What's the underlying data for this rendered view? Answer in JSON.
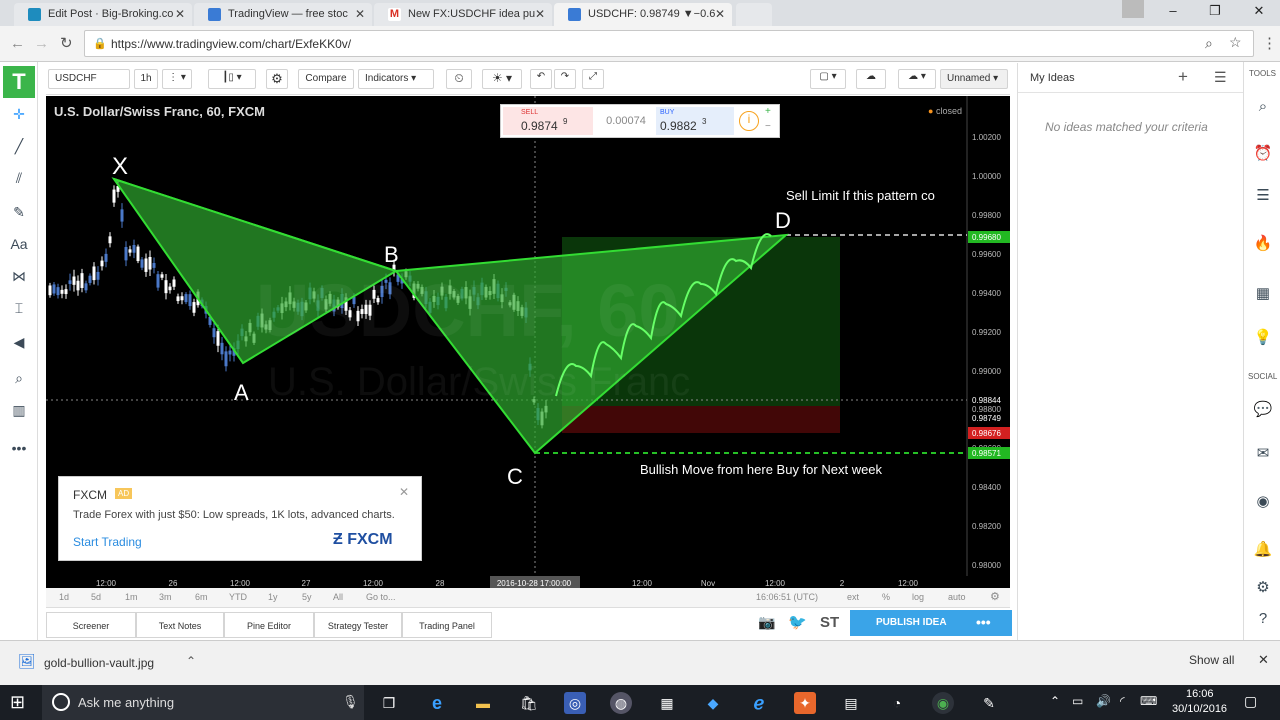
{
  "browser": {
    "tabs": [
      {
        "label": "Edit Post · Big-Broking.co",
        "icon_color": "#1e8cbe"
      },
      {
        "label": "TradingView — free stoc",
        "icon_color": "#3a7bd5"
      },
      {
        "label": "New FX:USDCHF idea pu",
        "icon_color": "#d93025"
      },
      {
        "label": "USDCHF: 0.98749 ▼−0.6",
        "icon_color": "#3a7bd5"
      }
    ],
    "url_secure": "https://",
    "url": "https://www.tradingview.com/chart/ExfeKK0v/"
  },
  "toolbar": {
    "symbol": "USDCHF",
    "interval": "1h",
    "compare": "Compare",
    "indicators": "Indicators",
    "layout_name": "Unnamed"
  },
  "chart": {
    "title": "U.S. Dollar/Swiss Franc, 60, FXCM",
    "watermark_symbol": "USDCHF, 60",
    "watermark_name": "U.S. Dollar/Swiss Franc",
    "market_status": "closed",
    "trade": {
      "sell_label": "SELL",
      "sell_price": "0.9874",
      "sell_sup": "9",
      "spread": "0.00074",
      "buy_label": "BUY",
      "buy_price": "0.9882",
      "buy_sup": "3"
    },
    "annotations": {
      "x": "X",
      "a": "A",
      "b": "B",
      "c": "C",
      "d": "D",
      "sell_note": "Sell Limit If this pattern co",
      "buy_note": "Bullish Move from here Buy for Next week"
    },
    "price_axis": [
      "1.00200",
      "1.00000",
      "0.99800",
      "0.99600",
      "0.99400",
      "0.99200",
      "0.99000",
      "0.98800",
      "0.98600",
      "0.98400",
      "0.98200",
      "0.98000"
    ],
    "price_tags": [
      {
        "label": "0.99680",
        "color": "#22b822"
      },
      {
        "label": "0.98844",
        "color": "#000000"
      },
      {
        "label": "0.98749",
        "color": "#000000"
      },
      {
        "label": "0.98676",
        "color": "#d32020"
      },
      {
        "label": "0.98571",
        "color": "#22b822"
      }
    ],
    "time_axis": [
      "12:00",
      "26",
      "12:00",
      "27",
      "12:00",
      "28",
      "2016-10-28 17:00:00",
      "12:00",
      "Nov",
      "12:00",
      "2",
      "12:00"
    ]
  },
  "ad": {
    "brand": "FXCM",
    "badge": "AD",
    "text": "Trade Forex with just $50: Low spreads, 1K lots, advanced charts.",
    "cta": "Start Trading",
    "logo": "FXCM"
  },
  "range": {
    "buttons": [
      "1d",
      "5d",
      "1m",
      "3m",
      "6m",
      "YTD",
      "1y",
      "5y",
      "All",
      "Go to..."
    ],
    "time": "16:06:51 (UTC)",
    "ext": "ext",
    "pct": "%",
    "log": "log",
    "auto": "auto"
  },
  "bottom_tabs": [
    "Screener",
    "Text Notes",
    "Pine Editor",
    "Strategy Tester",
    "Trading Panel"
  ],
  "publish": "PUBLISH IDEA",
  "ideas": {
    "title": "My Ideas",
    "empty": "No ideas matched your criteria"
  },
  "right_panel": {
    "tools_label": "TOOLS",
    "social_label": "SOCIAL"
  },
  "download": {
    "file": "gold-bullion-vault.jpg",
    "show_all": "Show all"
  },
  "taskbar": {
    "search": "Ask me anything",
    "time": "16:06",
    "date": "30/10/2016"
  }
}
